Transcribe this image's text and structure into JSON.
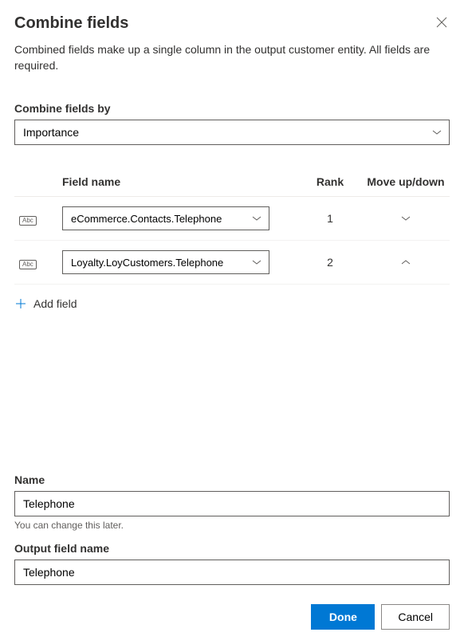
{
  "header": {
    "title": "Combine fields",
    "description": "Combined fields make up a single column in the output customer entity. All fields are required."
  },
  "combineBy": {
    "label": "Combine fields by",
    "value": "Importance"
  },
  "table": {
    "headers": {
      "field": "Field name",
      "rank": "Rank",
      "move": "Move up/down"
    },
    "rows": [
      {
        "typeBadge": "Abc",
        "field": "eCommerce.Contacts.Telephone",
        "rank": "1",
        "canMoveUp": false,
        "canMoveDown": true
      },
      {
        "typeBadge": "Abc",
        "field": "Loyalty.LoyCustomers.Telephone",
        "rank": "2",
        "canMoveUp": true,
        "canMoveDown": false
      }
    ]
  },
  "addField": {
    "label": "Add field"
  },
  "nameSection": {
    "label": "Name",
    "value": "Telephone",
    "helper": "You can change this later."
  },
  "outputSection": {
    "label": "Output field name",
    "value": "Telephone"
  },
  "buttons": {
    "done": "Done",
    "cancel": "Cancel"
  }
}
